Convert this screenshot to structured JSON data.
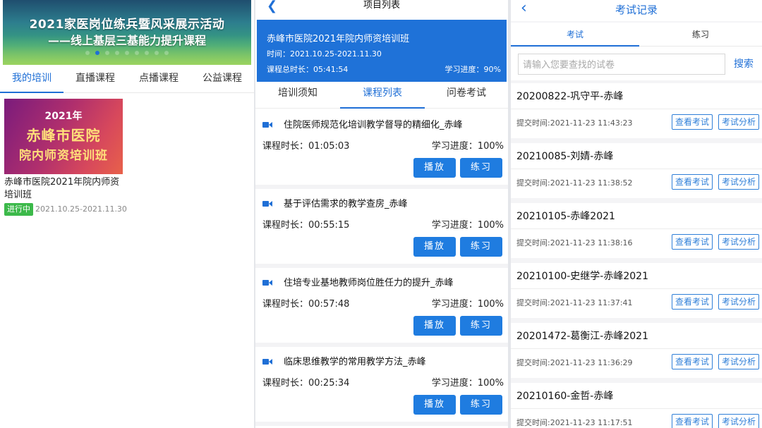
{
  "panel1": {
    "banner": {
      "line1": "2021家医岗位练兵暨风采展示活动",
      "line2": "——线上基层三基能力提升课程",
      "dot_count": 9,
      "active_dot": 1
    },
    "tabs": [
      {
        "label": "我的培训",
        "active": true
      },
      {
        "label": "直播课程",
        "active": false
      },
      {
        "label": "点播课程",
        "active": false
      },
      {
        "label": "公益课程",
        "active": false
      }
    ],
    "course": {
      "image_line1": "2021年",
      "image_line2": "赤峰市医院",
      "image_line3": "院内师资培训班",
      "title": "赤峰市医院2021年院内师资培训班",
      "status": "进行中",
      "date": "2021.10.25-2021.11.30"
    }
  },
  "panel2": {
    "back_icon": "chevron-left-icon",
    "title": "项目列表",
    "project": {
      "name": "赤峰市医院2021年院内师资培训班",
      "time": "时间：2021.10.25-2021.11.30",
      "duration": "课程总时长：05:41:54",
      "progress": "学习进度：90%"
    },
    "tabs": [
      {
        "label": "培训须知",
        "active": false
      },
      {
        "label": "课程列表",
        "active": true
      },
      {
        "label": "问卷考试",
        "active": false
      }
    ],
    "lessons": [
      {
        "title": "住院医师规范化培训教学督导的精细化_赤峰",
        "duration": "课程时长：01:05:03",
        "progress": "学习进度：100%",
        "play": "播放",
        "practice": "练习"
      },
      {
        "title": "基于评估需求的教学查房_赤峰",
        "duration": "课程时长：00:55:15",
        "progress": "学习进度：100%",
        "play": "播放",
        "practice": "练习"
      },
      {
        "title": "住培专业基地教师岗位胜任力的提升_赤峰",
        "duration": "课程时长：00:57:48",
        "progress": "学习进度：100%",
        "play": "播放",
        "practice": "练习"
      },
      {
        "title": "临床思维教学的常用教学方法_赤峰",
        "duration": "课程时长：00:25:34",
        "progress": "学习进度：100%",
        "play": "播放",
        "practice": "练习"
      }
    ],
    "accent": "#1f72d8"
  },
  "panel3": {
    "back_icon": "chevron-left-icon",
    "title": "考试记录",
    "tabs": [
      {
        "label": "考试",
        "active": true
      },
      {
        "label": "练习",
        "active": false
      }
    ],
    "search": {
      "placeholder": "请输入您要查找的试卷",
      "button": "搜索"
    },
    "records": [
      {
        "name": "20200822-巩守平-赤峰",
        "time": "提交时间:2021-11-23 11:43:23",
        "view": "查看考试",
        "analysis": "考试分析"
      },
      {
        "name": "20210085-刘婧-赤峰",
        "time": "提交时间:2021-11-23 11:38:52",
        "view": "查看考试",
        "analysis": "考试分析"
      },
      {
        "name": "20210105-赤峰2021",
        "time": "提交时间:2021-11-23 11:38:16",
        "view": "查看考试",
        "analysis": "考试分析"
      },
      {
        "name": "20210100-史继学-赤峰2021",
        "time": "提交时间:2021-11-23 11:37:41",
        "view": "查看考试",
        "analysis": "考试分析"
      },
      {
        "name": "20201472-葛衡江-赤峰2021",
        "time": "提交时间:2021-11-23 11:36:29",
        "view": "查看考试",
        "analysis": "考试分析"
      },
      {
        "name": "20210160-金哲-赤峰",
        "time": "提交时间:2021-11-23 11:17:51",
        "view": "查看考试",
        "analysis": "考试分析"
      }
    ]
  }
}
